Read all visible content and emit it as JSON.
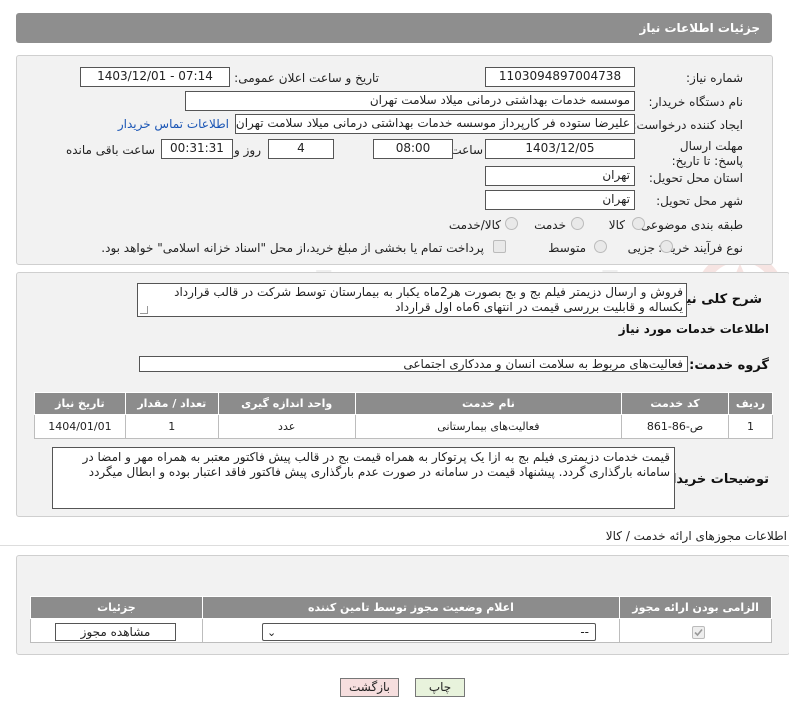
{
  "header": {
    "title": "جزئیات اطلاعات نیاز"
  },
  "form": {
    "need_number_label": "شماره نیاز:",
    "need_number": "1103094897004738",
    "announce_label": "تاریخ و ساعت اعلان عمومی:",
    "announce_value": "1403/12/01 - 07:14",
    "buyer_label": "نام دستگاه خریدار:",
    "buyer_value": "موسسه خدمات بهداشتی درمانی میلاد سلامت تهران",
    "creator_label": "ایجاد کننده درخواست:",
    "creator_value": "علیرضا ستوده فر کارپرداز موسسه خدمات بهداشتی درمانی میلاد سلامت تهران",
    "contact_link": "اطلاعات تماس خریدار",
    "deadline_label": "مهلت ارسال پاسخ: تا تاریخ:",
    "deadline_date": "1403/12/05",
    "time_label": "ساعت",
    "deadline_time": "08:00",
    "days_value": "4",
    "days_label": "روز و",
    "remaining_time": "00:31:31",
    "remaining_label": "ساعت باقی مانده",
    "province_label": "استان محل تحویل:",
    "province_value": "تهران",
    "city_label": "شهر محل تحویل:",
    "city_value": "تهران",
    "category_label": "طبقه بندی موضوعی:",
    "category_options": [
      "کالا",
      "خدمت",
      "کالا/خدمت"
    ],
    "process_label": "نوع فرآیند خرید :",
    "process_options": [
      "جزیی",
      "متوسط"
    ],
    "payment_note": "پرداخت تمام یا بخشی از مبلغ خرید،از محل \"اسناد خزانه اسلامی\" خواهد بود."
  },
  "details": {
    "description_label": "شرح کلی نیاز:",
    "description_text": "فروش و ارسال دزیمتر فیلم بج  و بج بصورت هر2ماه یکبار به بیمارستان توسط شرکت در قالب قرارداد یکساله و قابلیت بررسی قیمت در انتهای 6ماه اول قرارداد",
    "services_title": "اطلاعات خدمات مورد نیاز",
    "group_label": "گروه خدمت:",
    "group_value": "فعالیت‌های مربوط به سلامت انسان و مددکاری اجتماعی",
    "table": {
      "headers": [
        "ردیف",
        "کد خدمت",
        "نام خدمت",
        "واحد اندازه گیری",
        "تعداد / مقدار",
        "تاریخ نیاز"
      ],
      "rows": [
        [
          "1",
          "ص-86-861",
          "فعالیت‌های بیمارستانی",
          "عدد",
          "1",
          "1404/01/01"
        ]
      ]
    },
    "buyer_notes_label": "توضیحات خریدار:",
    "buyer_notes_text": "قیمت خدمات دزیمتری فیلم بج به ازا یک پرتوکار به همراه قیمت بج در قالب پیش فاکتور معتبر به همراه مهر و امضا در سامانه بارگذاری گردد. پیشنهاد قیمت در سامانه در صورت عدم بارگذاری پیش فاکتور فاقد اعتبار بوده و ابطال میگردد"
  },
  "permits": {
    "title": "اطلاعات مجوزهای ارائه خدمت / کالا",
    "headers": [
      "الزامی بودن ارائه مجوز",
      "اعلام وضعیت مجوز توسط تامین کننده",
      "جزئیات"
    ],
    "select_value": "--",
    "view_button": "مشاهده مجوز"
  },
  "footer": {
    "print_button": "چاپ",
    "back_button": "بازگشت"
  },
  "watermark": {
    "text": "AriaTender.neT"
  },
  "colors": {
    "header_bg": "#8e8e8e",
    "link": "#1a55b5",
    "back_btn": "#f6dede",
    "print_btn": "#e8f3dc"
  }
}
